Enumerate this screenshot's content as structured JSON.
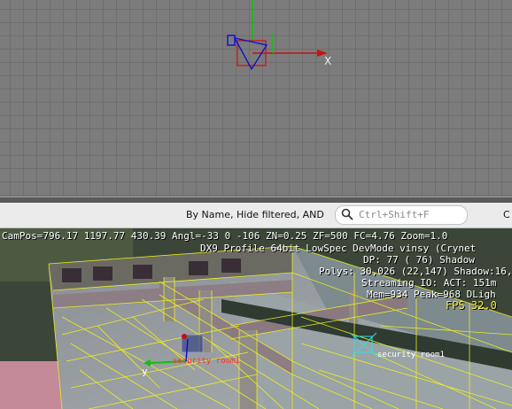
{
  "ortho_view": {
    "x_axis_label": "X",
    "colors": {
      "grid": "#7c7c7c",
      "x_axis": "#d01010",
      "y_axis": "#10c010",
      "camera": "#1010d0"
    }
  },
  "filter_bar": {
    "filter_text": "By Name, Hide filtered, AND",
    "search_placeholder": "Ctrl+Shift+F",
    "trailing_text": "C"
  },
  "hud": {
    "line1": "CamPos=796.17 1197.77 430.39 Angl=-33  0 -106 ZN=0.25 ZF=500 FC=4.76 Zoom=1.0",
    "line2": "DX9 Profile 64bit LowSpec DevMode vinsy (Crynet",
    "line3": "DP:   77 (  76) Shadow",
    "line4": "Polys: 30,026 (22,147) Shadow:16,",
    "line5": "Streaming IO: ACT: 151m",
    "line6": "Mem=934 Peak=968 DLigh",
    "fps": "FPS  32.0",
    "colors": {
      "text": "#ffffff",
      "fps": "#ffe93a"
    }
  },
  "scene_labels": {
    "security_room_a": "security room1",
    "security_room_b": "security room1",
    "y_axis": "y",
    "colors": {
      "wireframe": "#f2f21a",
      "label_a": "#ff3030",
      "label_b": "#ffffff",
      "cyan_helper": "#30e0e0"
    }
  }
}
